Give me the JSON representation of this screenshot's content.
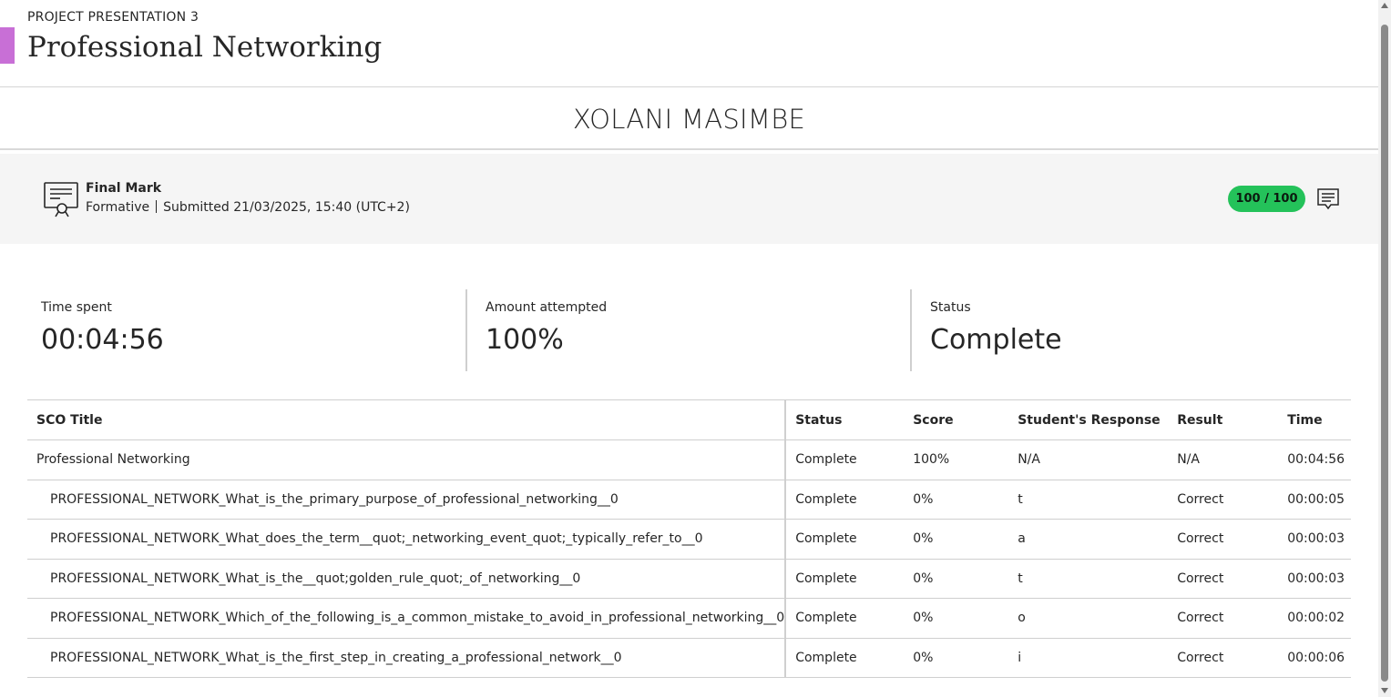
{
  "header": {
    "subtitle": "PROJECT PRESENTATION 3",
    "title": "Professional Networking",
    "back_glyph": "‹"
  },
  "student": {
    "name": "XOLANI MASIMBE"
  },
  "grade": {
    "icon": "certificate-icon",
    "name": "Final Mark",
    "type": "Formative",
    "submitted": "Submitted 21/03/2025, 15:40 (UTC+2)",
    "score": "100 / 100",
    "score_color": "#24c25a"
  },
  "stats": [
    {
      "label": "Time spent",
      "value": "00:04:56"
    },
    {
      "label": "Amount attempted",
      "value": "100%"
    },
    {
      "label": "Status",
      "value": "Complete"
    }
  ],
  "table": {
    "headers": [
      "SCO Title",
      "Status",
      "Score",
      "Student's Response",
      "Result",
      "Time"
    ],
    "rows": [
      {
        "title": "Professional Networking",
        "status": "Complete",
        "score": "100%",
        "response": "N/A",
        "result": "N/A",
        "time": "00:04:56",
        "indent": false
      },
      {
        "title": "PROFESSIONAL_NETWORK_What_is_the_primary_purpose_of_professional_networking__0",
        "status": "Complete",
        "score": "0%",
        "response": "t",
        "result": "Correct",
        "time": "00:00:05",
        "indent": true
      },
      {
        "title": "PROFESSIONAL_NETWORK_What_does_the_term__quot;_networking_event_quot;_typically_refer_to__0",
        "status": "Complete",
        "score": "0%",
        "response": "a",
        "result": "Correct",
        "time": "00:00:03",
        "indent": true
      },
      {
        "title": "PROFESSIONAL_NETWORK_What_is_the__quot;golden_rule_quot;_of_networking__0",
        "status": "Complete",
        "score": "0%",
        "response": "t",
        "result": "Correct",
        "time": "00:00:03",
        "indent": true
      },
      {
        "title": "PROFESSIONAL_NETWORK_Which_of_the_following_is_a_common_mistake_to_avoid_in_professional_networking__0",
        "status": "Complete",
        "score": "0%",
        "response": "o",
        "result": "Correct",
        "time": "00:00:02",
        "indent": true
      },
      {
        "title": "PROFESSIONAL_NETWORK_What_is_the_first_step_in_creating_a_professional_network__0",
        "status": "Complete",
        "score": "0%",
        "response": "i",
        "result": "Correct",
        "time": "00:00:06",
        "indent": true
      }
    ]
  }
}
